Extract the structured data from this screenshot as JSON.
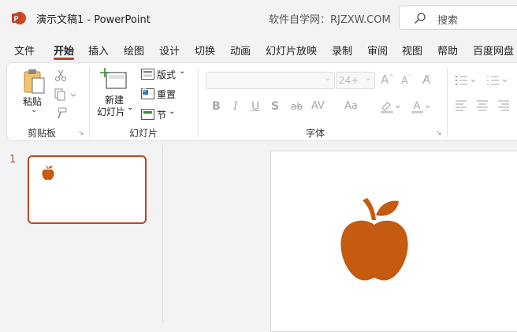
{
  "titlebar": {
    "doc_title": "演示文稿1  -  PowerPoint",
    "site_text": "软件自学网：RJZXW.COM",
    "search_label": "搜索"
  },
  "tabs": [
    "文件",
    "开始",
    "插入",
    "绘图",
    "设计",
    "切换",
    "动画",
    "幻灯片放映",
    "录制",
    "审阅",
    "视图",
    "帮助",
    "百度网盘"
  ],
  "active_tab": "开始",
  "ribbon": {
    "clipboard": {
      "paste_label": "粘贴",
      "group_label": "剪贴板"
    },
    "slides": {
      "new_slide_line1": "新建",
      "new_slide_line2": "幻灯片",
      "layout_label": "版式",
      "reset_label": "重置",
      "section_label": "节",
      "group_label": "幻灯片"
    },
    "font": {
      "font_name": "",
      "font_size": "24+",
      "bold": "B",
      "italic": "I",
      "underline": "U",
      "shadow": "S",
      "strike": "ab",
      "spacing": "AV",
      "case": "Aa",
      "group_label": "字体"
    }
  },
  "slides_panel": {
    "slide_number": "1"
  },
  "colors": {
    "accent": "#b7472a",
    "apple": "#c55a11"
  },
  "icons": [
    "powerpoint-logo-icon",
    "search-icon",
    "paste-icon",
    "cut-icon",
    "copy-icon",
    "format-painter-icon",
    "new-slide-icon",
    "layout-icon",
    "reset-icon",
    "section-icon",
    "apple-icon",
    "bullets-icon",
    "numbering-icon",
    "align-icons"
  ]
}
